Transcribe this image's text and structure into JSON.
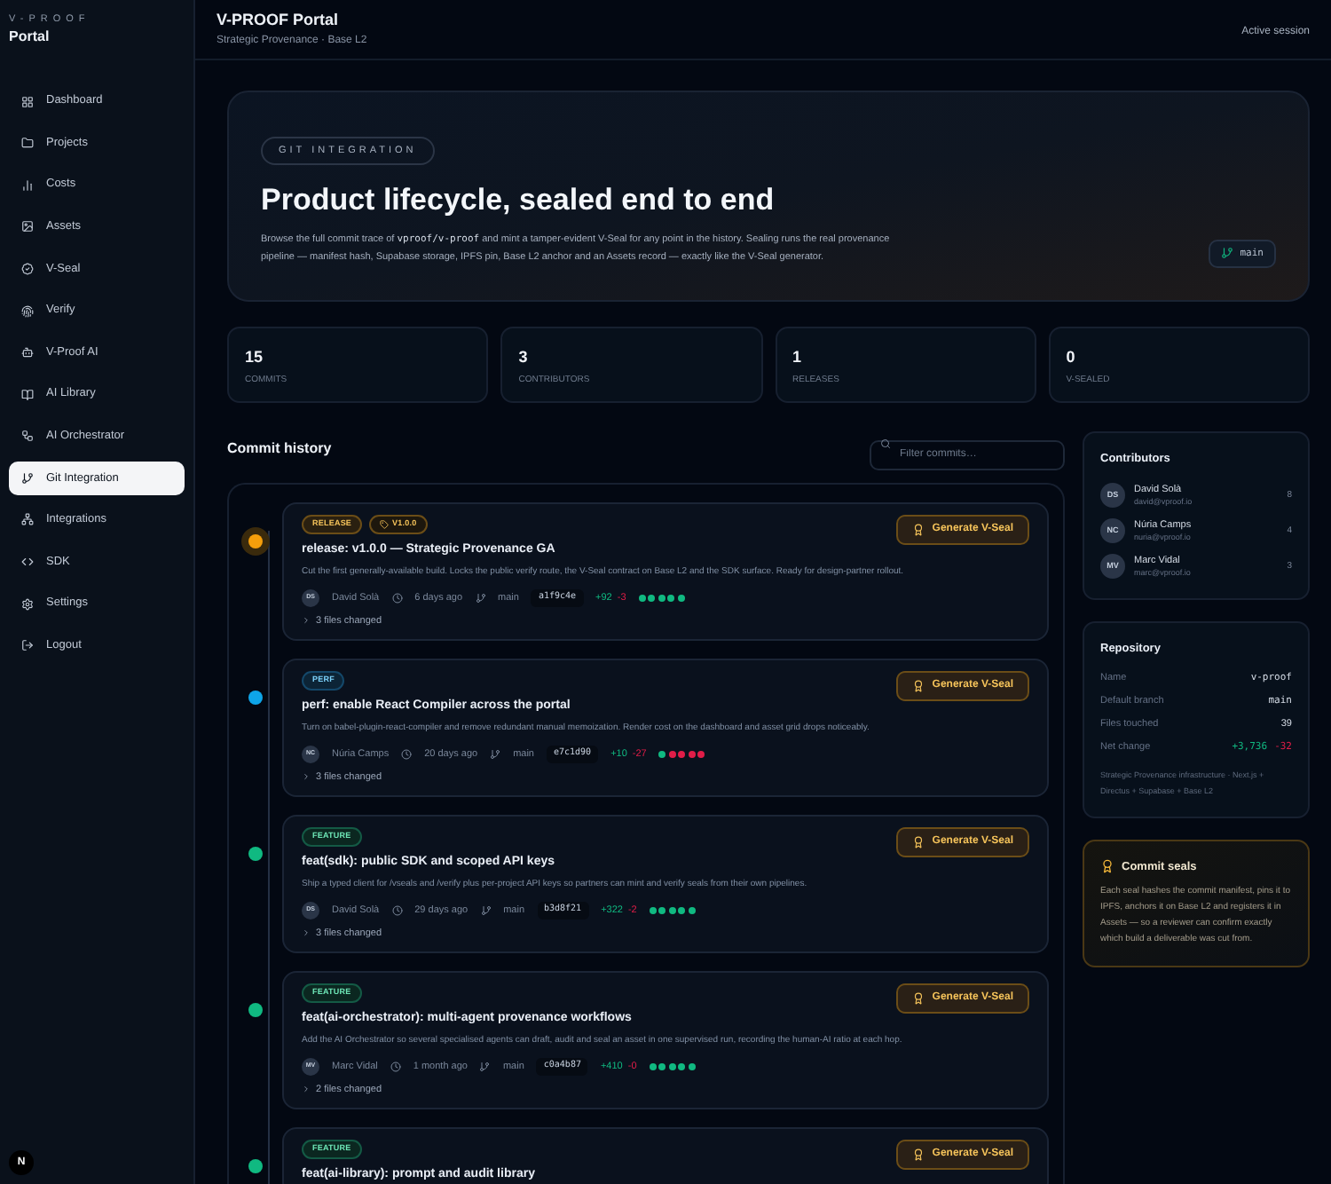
{
  "brand": {
    "kicker": "V-PROOF",
    "name": "Portal"
  },
  "sidebar": {
    "items": [
      {
        "label": "Dashboard",
        "selected": false
      },
      {
        "label": "Projects",
        "selected": false
      },
      {
        "label": "Costs",
        "selected": false
      },
      {
        "label": "Assets",
        "selected": false
      },
      {
        "label": "V-Seal",
        "selected": false
      },
      {
        "label": "Verify",
        "selected": false
      },
      {
        "label": "V-Proof AI",
        "selected": false
      },
      {
        "label": "AI Library",
        "selected": false
      },
      {
        "label": "AI Orchestrator",
        "selected": false
      },
      {
        "label": "Git Integration",
        "selected": true
      },
      {
        "label": "Integrations",
        "selected": false
      },
      {
        "label": "SDK",
        "selected": false
      },
      {
        "label": "Settings",
        "selected": false
      },
      {
        "label": "Logout",
        "selected": false
      }
    ],
    "badge": "N"
  },
  "header": {
    "title": "V-PROOF Portal",
    "subtitle": "Strategic Provenance · Base L2",
    "status": "Active session"
  },
  "hero": {
    "kicker": "GIT INTEGRATION",
    "title": "Product lifecycle, sealed end to end",
    "description_before": "Browse the full commit trace of ",
    "repo": "vproof/v-proof",
    "description_after": " and mint a tamper-evident V-Seal for any point in the history. Sealing runs the real provenance pipeline — manifest hash, Supabase storage, IPFS pin, Base L2 anchor and an Assets record — exactly like the V-Seal generator.",
    "branch": "main"
  },
  "stats": [
    {
      "value": "15",
      "label": "COMMITS"
    },
    {
      "value": "3",
      "label": "CONTRIBUTORS"
    },
    {
      "value": "1",
      "label": "RELEASES"
    },
    {
      "value": "0",
      "label": "V-SEALED"
    }
  ],
  "commit_history": {
    "title": "Commit history",
    "search": {
      "placeholder": "Filter commits…"
    },
    "commits": [
      {
        "color": "#f59e0b",
        "tags": [
          {
            "kind": "release",
            "label": "RELEASE"
          },
          {
            "kind": "version",
            "label": "V1.0.0"
          }
        ],
        "title": "release: v1.0.0 — Strategic Provenance GA",
        "description": "Cut the first generally-available build. Locks the public verify route, the V-Seal contract on Base L2 and the SDK surface. Ready for design-partner rollout.",
        "initials": "DS",
        "author": "David Solà",
        "time": "6 days ago",
        "branch": "main",
        "hash": "a1f9c4e",
        "additions": "+92",
        "deletions": "-3",
        "health": [
          {
            "color": "#10b981"
          },
          {
            "color": "#10b981"
          },
          {
            "color": "#10b981"
          },
          {
            "color": "#10b981"
          },
          {
            "color": "#10b981"
          }
        ],
        "files": "3 files changed",
        "action": "Generate V-Seal"
      },
      {
        "color": "#0ea5e9",
        "tags": [
          {
            "kind": "perf",
            "label": "PERF"
          }
        ],
        "title": "perf: enable React Compiler across the portal",
        "description": "Turn on babel-plugin-react-compiler and remove redundant manual memoization. Render cost on the dashboard and asset grid drops noticeably.",
        "initials": "NC",
        "author": "Núria Camps",
        "time": "20 days ago",
        "branch": "main",
        "hash": "e7c1d90",
        "additions": "+10",
        "deletions": "-27",
        "health": [
          {
            "color": "#10b981"
          },
          {
            "color": "#e11d48"
          },
          {
            "color": "#e11d48"
          },
          {
            "color": "#e11d48"
          },
          {
            "color": "#e11d48"
          }
        ],
        "files": "3 files changed",
        "action": "Generate V-Seal"
      },
      {
        "color": "#10b981",
        "tags": [
          {
            "kind": "feature",
            "label": "FEATURE"
          }
        ],
        "title": "feat(sdk): public SDK and scoped API keys",
        "description": "Ship a typed client for /vseals and /verify plus per-project API keys so partners can mint and verify seals from their own pipelines.",
        "initials": "DS",
        "author": "David Solà",
        "time": "29 days ago",
        "branch": "main",
        "hash": "b3d8f21",
        "additions": "+322",
        "deletions": "-2",
        "health": [
          {
            "color": "#10b981"
          },
          {
            "color": "#10b981"
          },
          {
            "color": "#10b981"
          },
          {
            "color": "#10b981"
          },
          {
            "color": "#10b981"
          }
        ],
        "files": "3 files changed",
        "action": "Generate V-Seal"
      },
      {
        "color": "#10b981",
        "tags": [
          {
            "kind": "feature",
            "label": "FEATURE"
          }
        ],
        "title": "feat(ai-orchestrator): multi-agent provenance workflows",
        "description": "Add the AI Orchestrator so several specialised agents can draft, audit and seal an asset in one supervised run, recording the human-AI ratio at each hop.",
        "initials": "MV",
        "author": "Marc Vidal",
        "time": "1 month ago",
        "branch": "main",
        "hash": "c0a4b87",
        "additions": "+410",
        "deletions": "-0",
        "health": [
          {
            "color": "#10b981"
          },
          {
            "color": "#10b981"
          },
          {
            "color": "#10b981"
          },
          {
            "color": "#10b981"
          },
          {
            "color": "#10b981"
          }
        ],
        "files": "2 files changed",
        "action": "Generate V-Seal"
      },
      {
        "color": "#10b981",
        "tags": [
          {
            "kind": "feature",
            "label": "FEATURE"
          }
        ],
        "title": "feat(ai-library): prompt and audit library",
        "action": "Generate V-Seal"
      }
    ]
  },
  "contributors": {
    "title": "Contributors",
    "items": [
      {
        "initials": "DS",
        "name": "David Solà",
        "email": "david@vproof.io",
        "count": "8"
      },
      {
        "initials": "NC",
        "name": "Núria Camps",
        "email": "nuria@vproof.io",
        "count": "4"
      },
      {
        "initials": "MV",
        "name": "Marc Vidal",
        "email": "marc@vproof.io",
        "count": "3"
      }
    ]
  },
  "repository": {
    "title": "Repository",
    "rows": [
      {
        "kind": "mono",
        "label": "Name",
        "value": "v-proof"
      },
      {
        "kind": "mono",
        "label": "Default branch",
        "value": "main"
      },
      {
        "kind": "plain",
        "label": "Files touched",
        "value": "39"
      },
      {
        "kind": "change",
        "label": "Net change",
        "additions": "+3,736",
        "deletions": "-32"
      }
    ],
    "note": "Strategic Provenance infrastructure · Next.js + Directus + Supabase + Base L2"
  },
  "commit_seals": {
    "title": "Commit seals",
    "text": "Each seal hashes the commit manifest, pins it to IPFS, anchors it on Base L2 and registers it in Assets — so a reviewer can confirm exactly which build a deliverable was cut from."
  }
}
